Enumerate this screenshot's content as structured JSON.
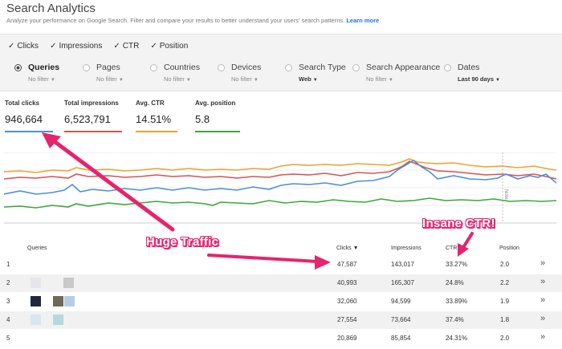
{
  "header": {
    "title": "Search Analytics",
    "subtitle": "Analyze your performance on Google Search. Filter and compare your results to better understand your users' search patterns.",
    "learn_more": "Learn more"
  },
  "metrics": [
    {
      "label": "Clicks",
      "checked": true
    },
    {
      "label": "Impressions",
      "checked": true
    },
    {
      "label": "CTR",
      "checked": true
    },
    {
      "label": "Position",
      "checked": true
    }
  ],
  "filters": [
    {
      "label": "Queries",
      "value": "No filter",
      "selected": true
    },
    {
      "label": "Pages",
      "value": "No filter",
      "selected": false
    },
    {
      "label": "Countries",
      "value": "No filter",
      "selected": false
    },
    {
      "label": "Devices",
      "value": "No filter",
      "selected": false
    },
    {
      "label": "Search Type",
      "value": "Web",
      "selected": false
    },
    {
      "label": "Search Appearance",
      "value": "No filter",
      "selected": false
    },
    {
      "label": "Dates",
      "value": "Last 90 days",
      "selected": false
    }
  ],
  "cards": [
    {
      "label": "Total clicks",
      "value": "946,664"
    },
    {
      "label": "Total impressions",
      "value": "6,523,791"
    },
    {
      "label": "Avg. CTR",
      "value": "14.51%"
    },
    {
      "label": "Avg. position",
      "value": "5.8"
    }
  ],
  "chart": {
    "note_label": "Note",
    "colors": {
      "clicks": "#4a90d9",
      "impressions": "#d9534f",
      "ctr": "#f0a030",
      "position": "#3aa83a"
    }
  },
  "table": {
    "headers": {
      "queries": "Queries",
      "clicks": "Clicks ▼",
      "impressions": "Impressions",
      "ctr": "CTR",
      "position": "Position"
    },
    "rows": [
      {
        "num": "1",
        "clicks": "47,587",
        "impressions": "143,017",
        "ctr": "33.27%",
        "position": "2.0"
      },
      {
        "num": "2",
        "clicks": "40,993",
        "impressions": "165,307",
        "ctr": "24.8%",
        "position": "2.2"
      },
      {
        "num": "3",
        "clicks": "32,060",
        "impressions": "94,599",
        "ctr": "33.89%",
        "position": "1.9"
      },
      {
        "num": "4",
        "clicks": "27,554",
        "impressions": "73,664",
        "ctr": "37.4%",
        "position": "1.8"
      },
      {
        "num": "5",
        "clicks": "20,869",
        "impressions": "85,854",
        "ctr": "24.31%",
        "position": "2.0"
      }
    ],
    "chevron": "»"
  },
  "annotations": {
    "huge_traffic": "Huge Traffic",
    "insane_ctr": "Insane CTR!",
    "color": "#e6246e"
  }
}
